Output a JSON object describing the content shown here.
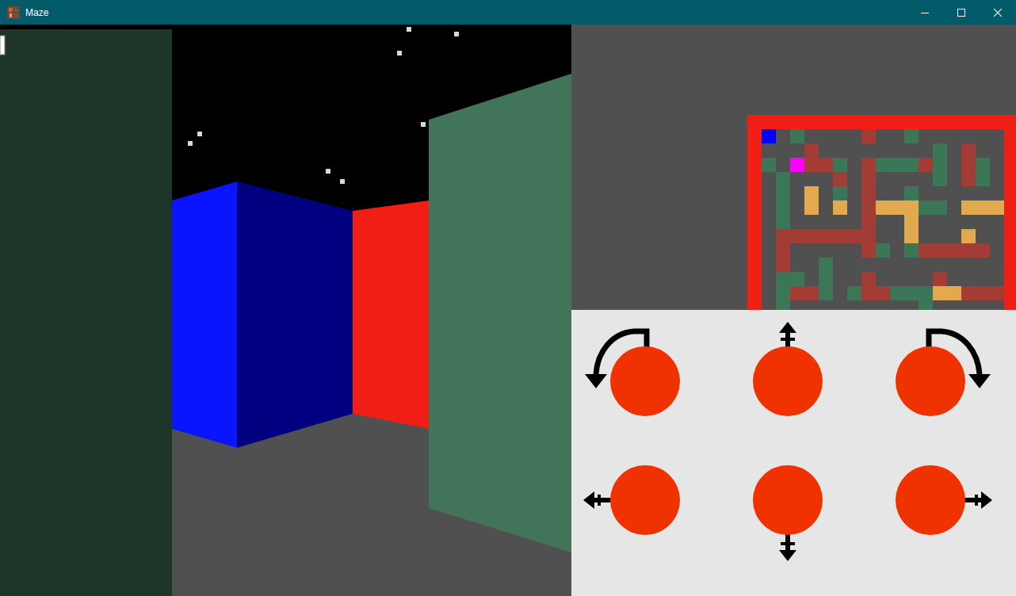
{
  "window": {
    "title": "Maze"
  },
  "view": {
    "walls": [
      {
        "color": "#1e3629"
      },
      {
        "color": "#0a14ff"
      },
      {
        "color": "#000080"
      },
      {
        "color": "#f01e14"
      },
      {
        "color": "#427459"
      }
    ]
  },
  "minimap": {
    "palette": {
      ".": "#505050",
      "g": "#3b7757",
      "r": "#a33c34",
      "y": "#e2a94e",
      "B": "#0000ff",
      "M": "#ff00ff"
    },
    "rows": [
      "B.g....r..g......",
      "...r........g.r..",
      "g.Mrrg.rgggrg.rg.",
      ".g...r.r....g.rg.",
      ".g.y.g.r..g......",
      ".g.y.y.ryyygg.yyy",
      ".g.....r..y......",
      ".rrrrrrr..y...y..",
      ".r.....rg.grrrrr.",
      ".r..g............",
      ".gg.g..r....r....",
      ".grrg.grrgggyyrrr",
      ".g.........g....."
    ]
  },
  "controls": [
    {
      "kind": "rotate-left"
    },
    {
      "kind": "forward"
    },
    {
      "kind": "rotate-right"
    },
    {
      "kind": "strafe-left"
    },
    {
      "kind": "back"
    },
    {
      "kind": "strafe-right"
    }
  ]
}
